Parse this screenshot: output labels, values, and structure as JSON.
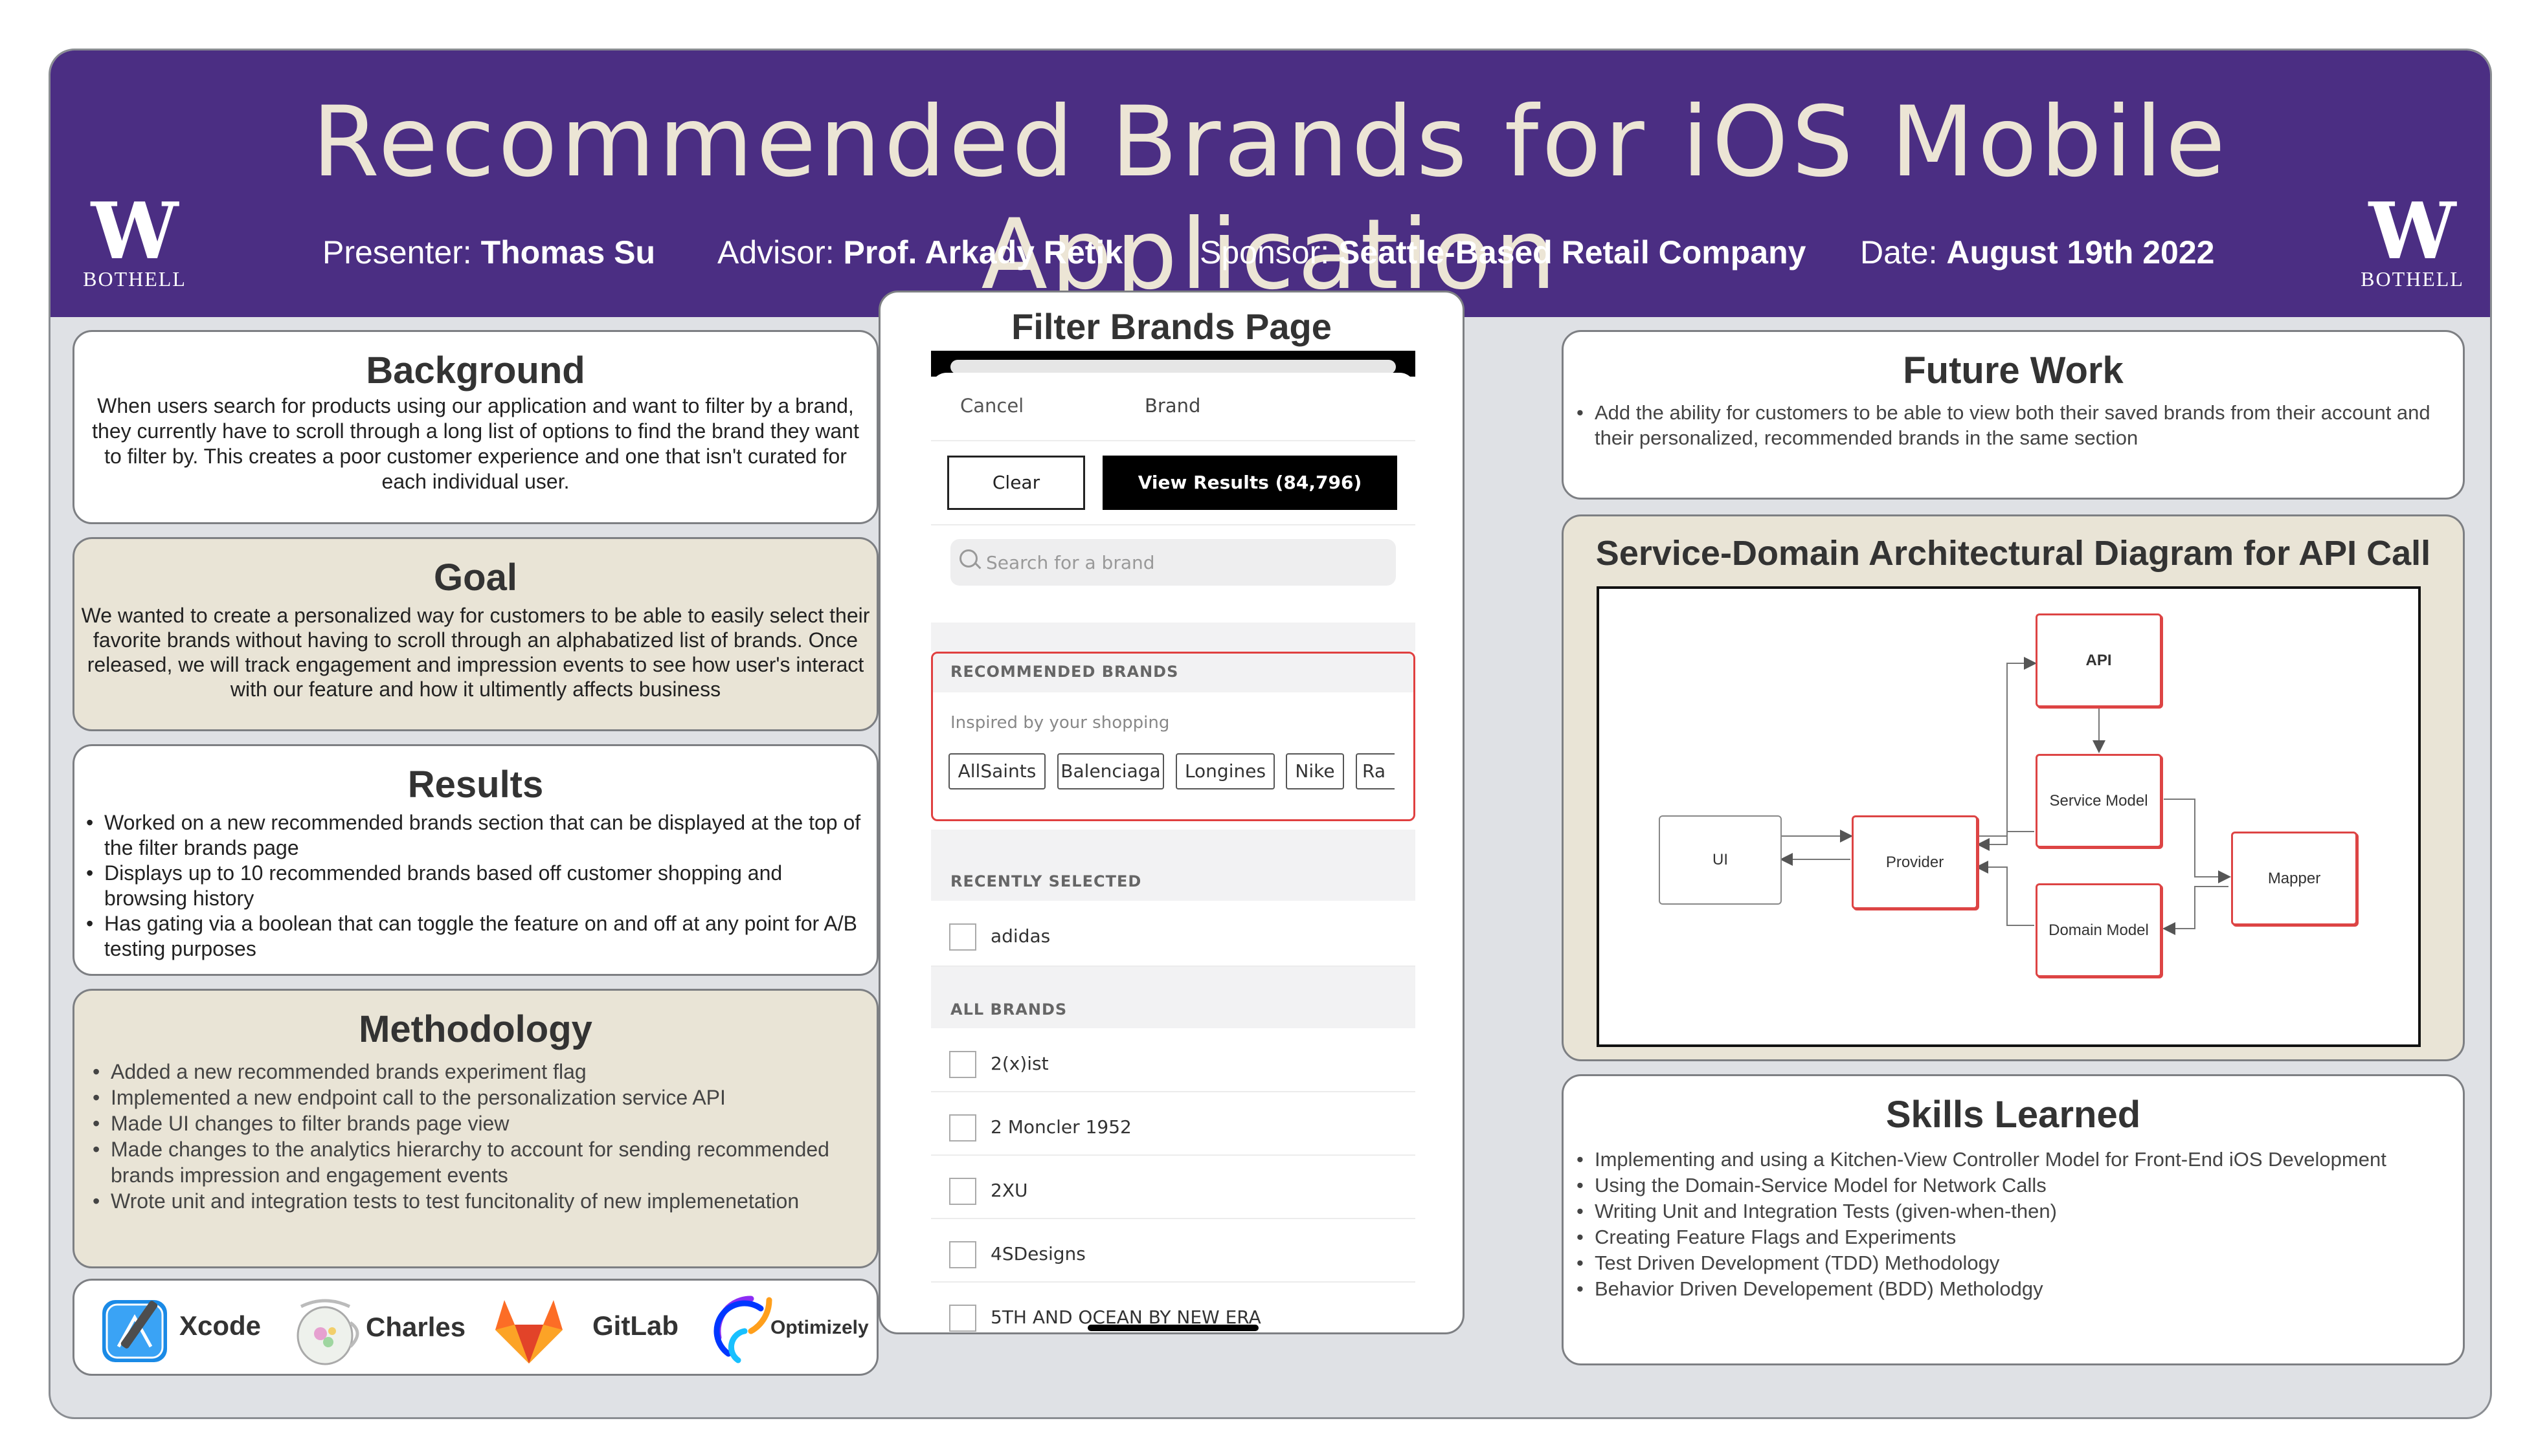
{
  "header": {
    "title": "Recommended Brands for iOS Mobile Application",
    "logo_left": {
      "letter": "W",
      "text": "BOTHELL"
    },
    "logo_right": {
      "letter": "W",
      "text": "BOTHELL"
    },
    "presenter_label": "Presenter:",
    "presenter": "Thomas Su",
    "advisor_label": "Advisor:",
    "advisor": "Prof. Arkady Retik",
    "sponsor_label": "Sponsor:",
    "sponsor": "Seattle-Based Retail Company",
    "date_label": "Date:",
    "date": "August 19th 2022"
  },
  "background": {
    "title": "Background",
    "text": "When users search for products using our application and want to filter by a brand, they currently have to scroll through a long list of options to find the brand they want to filter by. This creates a poor customer experience and one that isn't curated for each individual user."
  },
  "goal": {
    "title": "Goal",
    "text": "We wanted to create a personalized way for customers to be able to easily select their favorite brands without having to scroll through an alphabatized list of brands. Once released, we will track engagement and impression events to see how user's interact with our feature and how it ultimently affects business"
  },
  "results": {
    "title": "Results",
    "items": [
      "Worked on a new recommended brands section that can be displayed at the top of the filter brands page",
      "Displays up to 10 recommended brands based off customer shopping and browsing history",
      "Has gating via a boolean that can toggle the feature on and off at any point for A/B testing purposes"
    ]
  },
  "methodology": {
    "title": "Methodology",
    "items": [
      "Added a new recommended brands experiment flag",
      "Implemented a new endpoint call to the personalization service API",
      "Made UI changes to filter brands page view",
      "Made changes to the analytics hierarchy to account for sending recommended brands impression and engagement events",
      "Wrote unit and integration tests to test funcitonality of new implemenetation"
    ]
  },
  "tools": [
    {
      "name": "Xcode",
      "icon": "xcode-icon"
    },
    {
      "name": "Charles",
      "icon": "charles-icon"
    },
    {
      "name": "GitLab",
      "icon": "gitlab-icon"
    },
    {
      "name": "Optimizely",
      "icon": "optimizely-icon"
    }
  ],
  "filter_page": {
    "title": "Filter Brands Page",
    "cancel": "Cancel",
    "nav_title": "Brand",
    "clear": "Clear",
    "view_results": "View Results  (84,796)",
    "search_placeholder": "Search for a brand",
    "recommended_label": "RECOMMENDED BRANDS",
    "recommended_sub": "Inspired by your shopping",
    "chips": [
      "AllSaints",
      "Balenciaga",
      "Longines",
      "Nike",
      "Ra"
    ],
    "recent_label": "RECENTLY SELECTED",
    "recent": [
      "adidas"
    ],
    "all_label": "ALL BRANDS",
    "all": [
      "2(x)ist",
      "2 Moncler 1952",
      "2XU",
      "4SDesigns",
      "5TH AND OCEAN BY NEW ERA"
    ]
  },
  "future_work": {
    "title": "Future Work",
    "items": [
      "Add the ability for customers to be able to view both their saved brands from their account and their personalized, recommended brands in the same section"
    ]
  },
  "architecture": {
    "title": "Service-Domain Architectural Diagram for API Call",
    "nodes": {
      "ui": "UI",
      "provider": "Provider",
      "api": "API",
      "service": "Service Model",
      "domain": "Domain Model",
      "mapper": "Mapper"
    }
  },
  "skills": {
    "title": "Skills Learned",
    "items": [
      "Implementing and using a Kitchen-View Controller Model for Front-End iOS Development",
      "Using the Domain-Service Model for Network Calls",
      "Writing Unit and Integration Tests (given-when-then)",
      "Creating Feature Flags and Experiments",
      "Test Driven Development (TDD) Methodology",
      "Behavior Driven Developement (BDD) Metholodgy"
    ]
  },
  "colors": {
    "header": "#4b2e83",
    "title_text": "#ece5d5",
    "tan_panel": "#e9e4d6",
    "highlight_red": "#e04040"
  }
}
